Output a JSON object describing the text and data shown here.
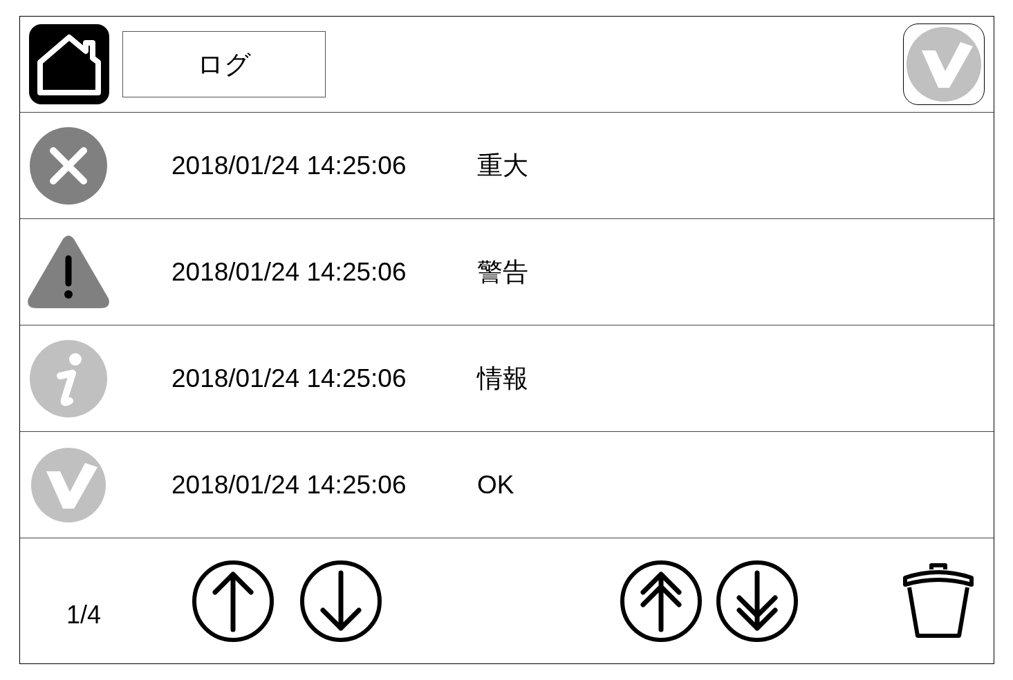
{
  "header": {
    "title": "ログ"
  },
  "rows": [
    {
      "kind": "error",
      "timestamp": "2018/01/24 14:25:06",
      "message": "重大"
    },
    {
      "kind": "warning",
      "timestamp": "2018/01/24 14:25:06",
      "message": "警告"
    },
    {
      "kind": "info",
      "timestamp": "2018/01/24 14:25:06",
      "message": "情報"
    },
    {
      "kind": "ok",
      "timestamp": "2018/01/24 14:25:06",
      "message": "OK"
    }
  ],
  "footer": {
    "page": "1/4"
  }
}
